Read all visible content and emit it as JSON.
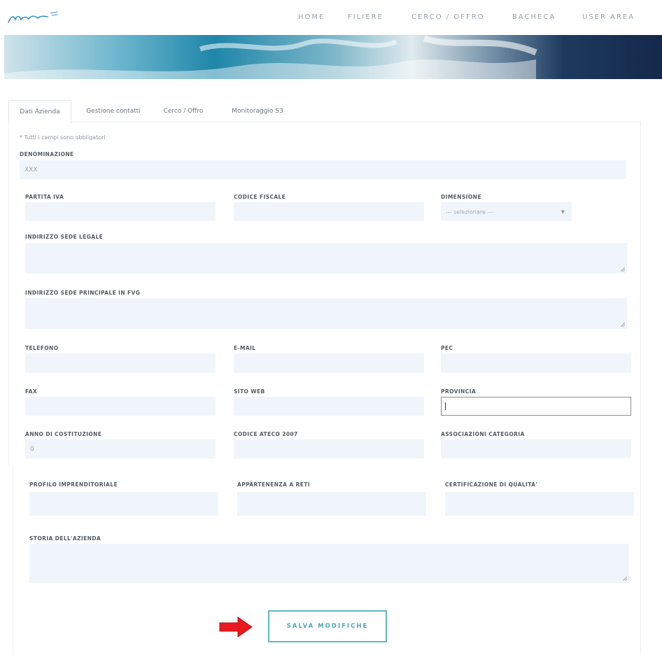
{
  "header": {
    "logo_name": "mare-logo-icon",
    "nav": [
      "HOME",
      "FILIERE",
      "CERCO / OFFRO",
      "BACHECA",
      "USER AREA"
    ]
  },
  "tabs": [
    "Dati Azienda",
    "Gestione contatti",
    "Cerco / Offro",
    "Monitoraggio S3"
  ],
  "form": {
    "required_note": "* Tutti i campi sono obbligatori",
    "denominazione": {
      "label": "DENOMINAZIONE",
      "value": "XXX"
    },
    "partita_iva": {
      "label": "PARTITA IVA",
      "value": ""
    },
    "codice_fiscale": {
      "label": "CODICE FISCALE",
      "value": ""
    },
    "dimensione": {
      "label": "DIMENSIONE",
      "value": "--- selezionare ---"
    },
    "indirizzo_legale": {
      "label": "INDIRIZZO SEDE LEGALE",
      "value": ""
    },
    "indirizzo_principale": {
      "label": "INDIRIZZO SEDE PRINCIPALE IN FVG",
      "value": ""
    },
    "telefono": {
      "label": "TELEFONO",
      "value": ""
    },
    "email": {
      "label": "E-MAIL",
      "value": ""
    },
    "pec": {
      "label": "PEC",
      "value": ""
    },
    "fax": {
      "label": "FAX",
      "value": ""
    },
    "sito_web": {
      "label": "SITO WEB",
      "value": ""
    },
    "provincia": {
      "label": "PROVINCIA",
      "value": ""
    },
    "anno_costituzione": {
      "label": "ANNO DI COSTITUZIONE",
      "value": "0"
    },
    "codice_ateco": {
      "label": "CODICE ATECO 2007",
      "value": ""
    },
    "associazioni": {
      "label": "ASSOCIAZIONI CATEGORIA",
      "value": ""
    },
    "profilo": {
      "label": "PROFILO IMPRENDITORIALE",
      "value": ""
    },
    "reti": {
      "label": "APPARTENENZA A RETI",
      "value": ""
    },
    "certificazione": {
      "label": "CERTIFICAZIONE DI QUALITA'",
      "value": ""
    },
    "storia": {
      "label": "STORIA DELL'AZIENDA",
      "value": ""
    }
  },
  "save_button": "SALVA MODIFICHE",
  "colors": {
    "accent": "#5fb8c7",
    "field_bg": "#f0f5fc",
    "arrow": "#e8191f"
  }
}
